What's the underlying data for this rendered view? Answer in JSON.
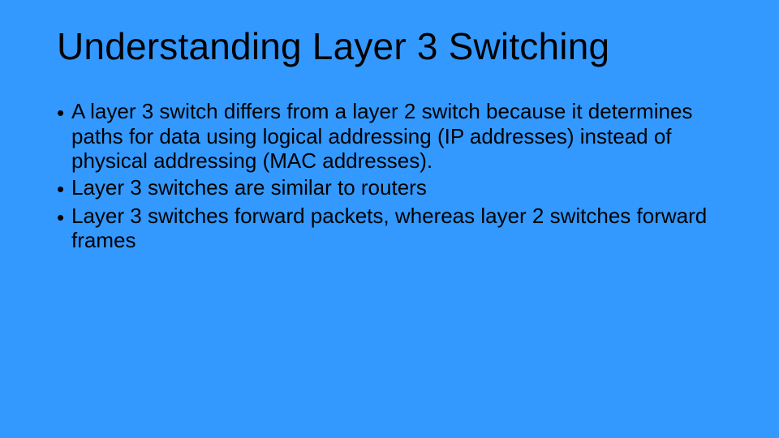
{
  "slide": {
    "title": "Understanding Layer 3 Switching",
    "bullets": [
      "A layer 3 switch differs from a layer 2 switch because it determines paths for data using logical addressing (IP addresses) instead of physical addressing (MAC addresses).",
      "Layer 3 switches are similar to routers",
      "Layer 3 switches forward packets, whereas layer 2 switches forward frames"
    ],
    "bullet_char": "•"
  },
  "colors": {
    "background": "#3399ff",
    "text": "#000000"
  }
}
